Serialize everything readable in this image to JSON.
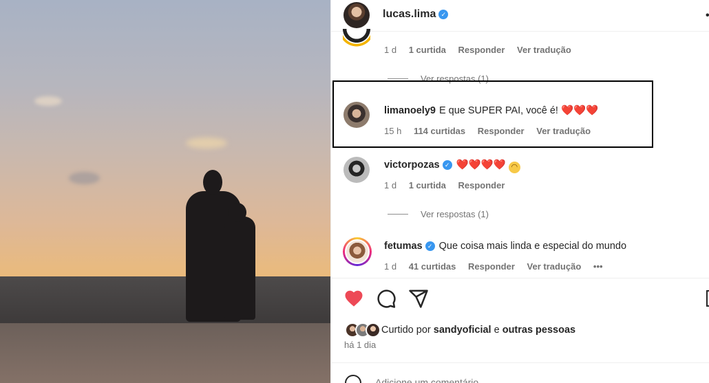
{
  "post": {
    "author": "lucas.lima",
    "more_icon": "more-horizontal-icon"
  },
  "comments": [
    {
      "username": "",
      "text": "",
      "age": "1 d",
      "likes": "1 curtida",
      "reply_label": "Responder",
      "translate_label": "Ver tradução",
      "view_replies": "Ver respostas (1)"
    },
    {
      "username": "limanoely9",
      "text": "E que SUPER PAI, você é! ❤️❤️❤️",
      "age": "15 h",
      "likes": "114 curtidas",
      "reply_label": "Responder",
      "translate_label": "Ver tradução"
    },
    {
      "username": "victorpozas",
      "text": "❤️❤️❤️❤️",
      "age": "1 d",
      "likes": "1 curtida",
      "reply_label": "Responder",
      "view_replies": "Ver respostas (1)"
    },
    {
      "username": "fetumas",
      "text": "Que coisa mais linda e especial do mundo",
      "age": "1 d",
      "likes": "41 curtidas",
      "reply_label": "Responder",
      "translate_label": "Ver tradução",
      "more": "•••"
    }
  ],
  "actions": {
    "like_icon": "heart-filled-icon",
    "comment_icon": "comment-icon",
    "share_icon": "share-icon",
    "save_icon": "bookmark-icon"
  },
  "likes_summary": {
    "prefix": "Curtido por",
    "first_user": "sandyoficial",
    "connector": "e",
    "others": "outras pessoas",
    "time_ago": "há 1 dia"
  },
  "add_comment": {
    "placeholder": "Adicione um comentário..."
  },
  "colors": {
    "like_red": "#ed4956",
    "verified_blue": "#3897f0",
    "muted_text": "#737373"
  }
}
